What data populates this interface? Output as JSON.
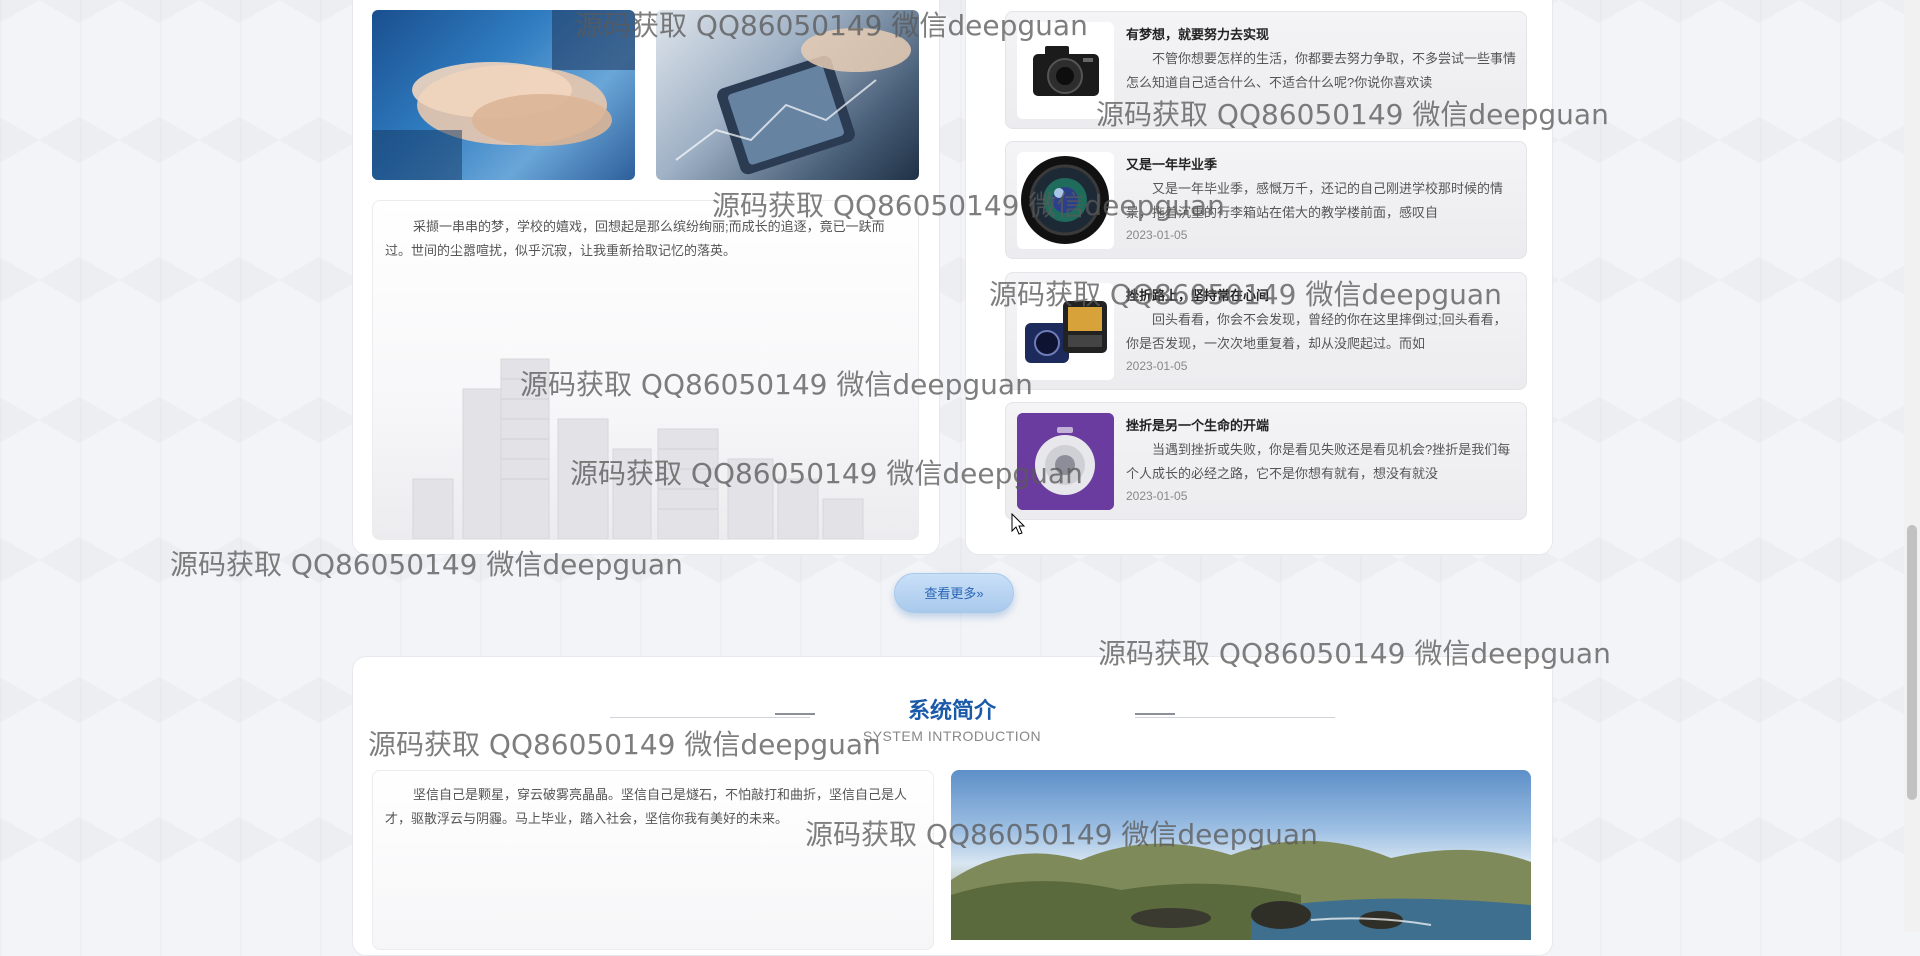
{
  "left_panel": {
    "quote": "采撷一串串的梦，学校的嬉戏，回想起是那么缤纷绚丽;而成长的追逐，竟已一趺而过。世间的尘嚣喧扰，似乎沉寂，让我重新拾取记忆的落英。"
  },
  "news": {
    "items": [
      {
        "title": "有梦想，就要努力去实现",
        "desc": "不管你想要怎样的生活，你都要去努力争取，不多尝试一些事情怎么知道自己适合什么、不适合什么呢?你说你喜欢读",
        "date": "",
        "thumb_icon": "camera-icon"
      },
      {
        "title": "又是一年毕业季",
        "desc": "又是一年毕业季，感慨万千，还记的自己刚进学校那时候的情景，拖着沉重的行李箱站在偌大的教学楼前面，感叹自",
        "date": "2023-01-05",
        "thumb_icon": "lens-icon"
      },
      {
        "title": "挫折路上，坚持常在心间",
        "desc": "回头看看，你会不会发现，曾经的你在这里摔倒过;回头看看，你是否发现，一次次地重复着，却从没爬起过。而如",
        "date": "2023-01-05",
        "thumb_icon": "dashcam-icon"
      },
      {
        "title": "挫折是另一个生命的开端",
        "desc": "当遇到挫折或失败，你是看见失败还是看见机会?挫折是我们每个人成长的必经之路，它不是你想有就有，想没有就没",
        "date": "2023-01-05",
        "thumb_icon": "webcam-icon"
      }
    ]
  },
  "more_button": {
    "label": "查看更多»"
  },
  "intro": {
    "title": "系统简介",
    "subtitle": "SYSTEM INTRODUCTION",
    "text": "坚信自己是颗星，穿云破雾亮晶晶。坚信自己是燧石，不怕敲打和曲折，坚信自己是人才，驱散浮云与阴霾。马上毕业，踏入社会，坚信你我有美好的未来。"
  },
  "watermark": {
    "text": "源码获取 QQ86050149 微信deepguan"
  },
  "colors": {
    "accent": "#1a5aa8",
    "button_bg": "#b8d4f2"
  }
}
